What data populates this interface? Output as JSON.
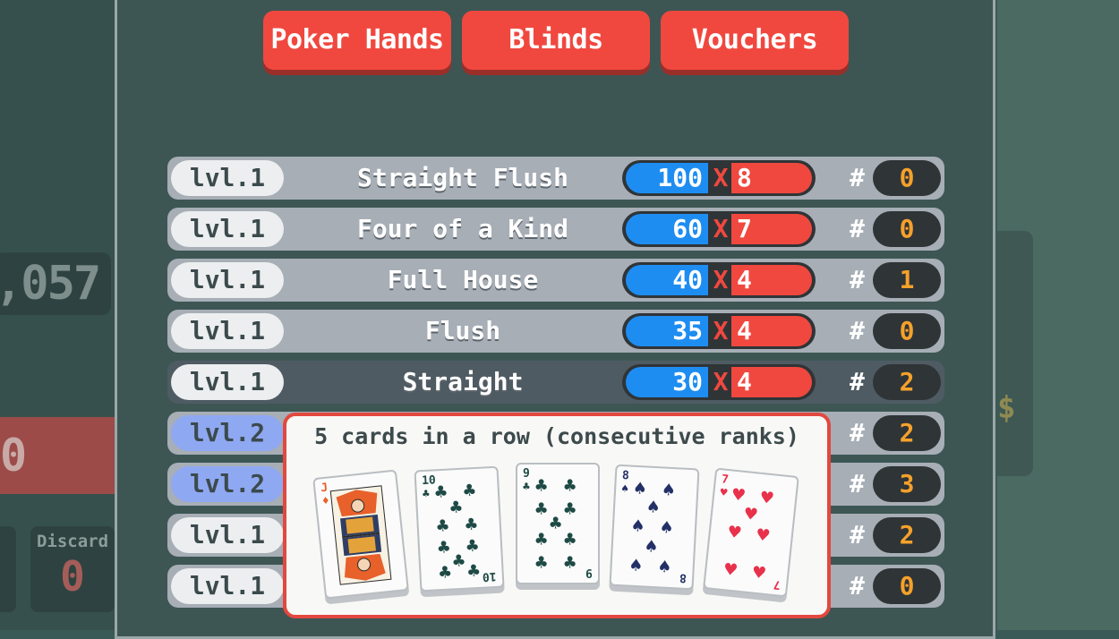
{
  "tabs": [
    "Poker Hands",
    "Blinds",
    "Vouchers"
  ],
  "background": {
    "score_fragment": ",057",
    "red_fragment": "0",
    "discard_label": "Discard",
    "discard_value": "0",
    "dollar_sign": "$"
  },
  "hands": [
    {
      "level": "lvl.1",
      "name": "Straight Flush",
      "chips": "100",
      "mult": "8",
      "played": "0"
    },
    {
      "level": "lvl.1",
      "name": "Four of a Kind",
      "chips": "60",
      "mult": "7",
      "played": "0"
    },
    {
      "level": "lvl.1",
      "name": "Full House",
      "chips": "40",
      "mult": "4",
      "played": "1"
    },
    {
      "level": "lvl.1",
      "name": "Flush",
      "chips": "35",
      "mult": "4",
      "played": "0"
    },
    {
      "level": "lvl.1",
      "name": "Straight",
      "chips": "30",
      "mult": "4",
      "played": "2"
    },
    {
      "level": "lvl.2",
      "name": "",
      "chips": "",
      "mult": "",
      "played": "2"
    },
    {
      "level": "lvl.2",
      "name": "",
      "chips": "",
      "mult": "",
      "played": "3"
    },
    {
      "level": "lvl.1",
      "name": "",
      "chips": "",
      "mult": "",
      "played": "2"
    },
    {
      "level": "lvl.1",
      "name": "",
      "chips": "",
      "mult": "",
      "played": "0"
    }
  ],
  "x_symbol": "X",
  "hash_symbol": "#",
  "tooltip": {
    "description": "5 cards in a row (consecutive ranks)",
    "cards": [
      {
        "rank": "J",
        "suit": "♦"
      },
      {
        "rank": "10",
        "suit": "♣"
      },
      {
        "rank": "9",
        "suit": "♣"
      },
      {
        "rank": "8",
        "suit": "♠"
      },
      {
        "rank": "7",
        "suit": "♥"
      }
    ]
  },
  "colors": {
    "tab_red": "#f0483f",
    "chips_blue": "#1e8df2",
    "mult_red": "#f0483f",
    "count_orange": "#f5a12b",
    "level_blue": "#8fa8f2"
  }
}
